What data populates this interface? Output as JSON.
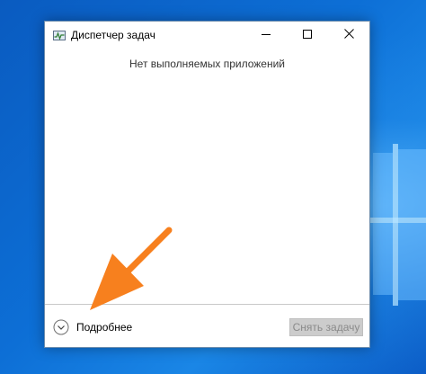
{
  "window": {
    "title": "Диспетчер задач",
    "empty_message": "Нет выполняемых приложений",
    "more_details_label": "Подробнее",
    "end_task_label": "Снять задачу"
  },
  "icons": {
    "app": "task-manager-icon",
    "minimize": "minimize-icon",
    "maximize": "maximize-icon",
    "close": "close-icon",
    "expand": "chevron-down-circle-icon",
    "pointer": "orange-arrow-annotation"
  },
  "colors": {
    "accent_arrow": "#f7801e",
    "desktop_blue": "#0d6fd6",
    "disabled_button": "#cccccc"
  }
}
